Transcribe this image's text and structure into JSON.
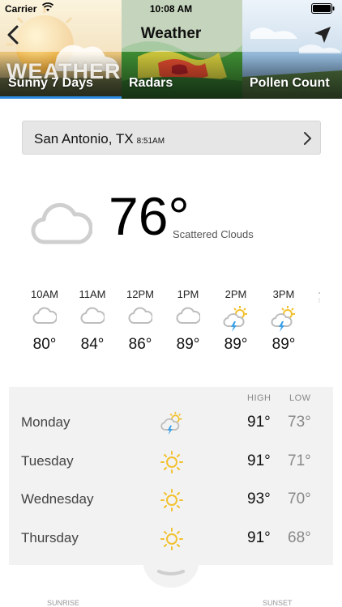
{
  "status_bar": {
    "carrier": "Carrier",
    "time": "10:08 AM"
  },
  "nav": {
    "title": "Weather"
  },
  "tabs": [
    {
      "label": "Sunny 7 Days",
      "logo_text": "WEATHER",
      "active": true
    },
    {
      "label": "Radars",
      "active": false
    },
    {
      "label": "Pollen Count",
      "active": false
    }
  ],
  "location": {
    "city": "San Antonio, TX",
    "time": "8:51AM"
  },
  "current": {
    "temp": "76°",
    "condition": "Scattered Clouds",
    "icon": "cloud-icon"
  },
  "hourly": [
    {
      "time": "10AM",
      "temp": "80°",
      "icon": "cloud-icon"
    },
    {
      "time": "11AM",
      "temp": "84°",
      "icon": "cloud-icon"
    },
    {
      "time": "12PM",
      "temp": "86°",
      "icon": "cloud-icon"
    },
    {
      "time": "1PM",
      "temp": "89°",
      "icon": "cloud-icon"
    },
    {
      "time": "2PM",
      "temp": "89°",
      "icon": "thunderstorm-icon"
    },
    {
      "time": "3PM",
      "temp": "89°",
      "icon": "thunderstorm-icon"
    }
  ],
  "daily": {
    "high_label": "HIGH",
    "low_label": "LOW",
    "days": [
      {
        "name": "Monday",
        "high": "91°",
        "low": "73°",
        "icon": "thunderstorm-icon"
      },
      {
        "name": "Tuesday",
        "high": "91°",
        "low": "71°",
        "icon": "sun-icon"
      },
      {
        "name": "Wednesday",
        "high": "93°",
        "low": "70°",
        "icon": "sun-icon"
      },
      {
        "name": "Thursday",
        "high": "91°",
        "low": "68°",
        "icon": "sun-icon"
      }
    ]
  },
  "sun_labels": {
    "sunrise": "SUNRISE",
    "sunset": "SUNSET"
  },
  "colors": {
    "accent": "#2a8be0",
    "sun": "#f2c12e",
    "bolt": "#3aa0e8",
    "cloud": "#c8c8c8"
  }
}
